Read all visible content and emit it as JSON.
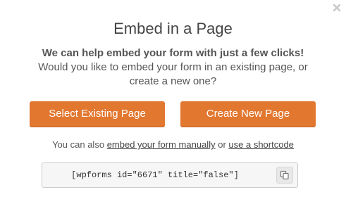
{
  "dialog": {
    "title": "Embed in a Page",
    "close_icon": "close-icon",
    "description_line1": "We can help embed your form with just a few clicks!",
    "description_line2": "Would you like to embed your form in an existing page, or",
    "description_line3": "create a new one?"
  },
  "actions": {
    "select_existing_label": "Select Existing Page",
    "create_new_label": "Create New Page",
    "button_color": "#e27730"
  },
  "alternatives": {
    "prefix": "You can also",
    "manual_link": "embed your form manually",
    "connector": "or",
    "shortcode_link": "use a shortcode"
  },
  "shortcode": {
    "value": "[wpforms id=\"6671\" title=\"false\"]",
    "copy_icon": "copy-icon"
  }
}
